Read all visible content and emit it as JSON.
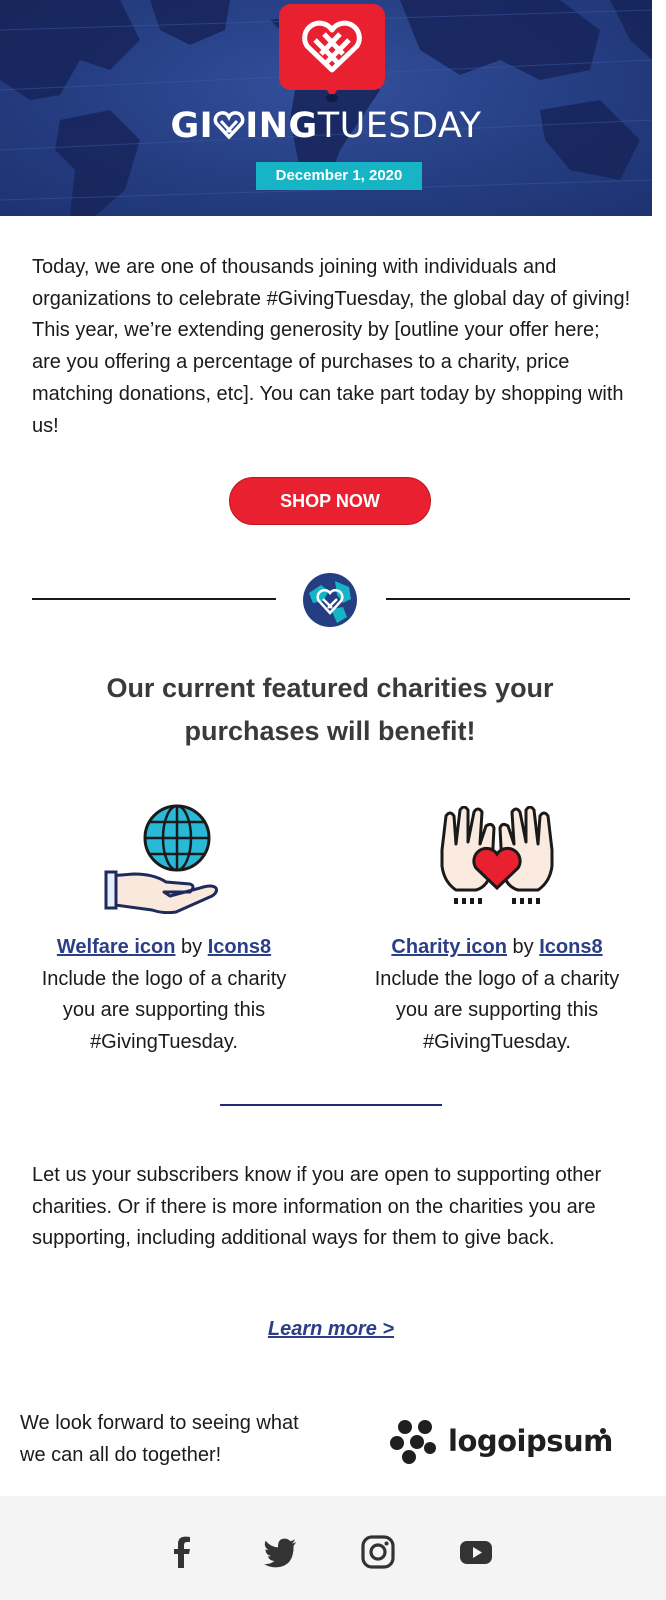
{
  "hero": {
    "brand_part1": "GI",
    "brand_part2": "ING",
    "brand_part3": "TUESDAY",
    "date": "December 1, 2020"
  },
  "intro_text": "Today, we are one of thousands joining with individuals and organizations to celebrate #GivingTuesday, the global day of giving! This year, we’re extending generosity by [outline your offer here; are you offering a percentage of purchases to a charity, price matching donations, etc]. You can take part today by shopping with us!",
  "shop_button": "SHOP NOW",
  "featured_heading": "Our current featured charities your purchases will benefit!",
  "charities": [
    {
      "icon_link": "Welfare icon",
      "by": "by",
      "author_link": "Icons8",
      "description": "Include the logo of a charity you are supporting this #GivingTuesday."
    },
    {
      "icon_link": "Charity icon",
      "by": "by",
      "author_link": "Icons8",
      "description": "Include the logo of a charity you are supporting this #GivingTuesday."
    }
  ],
  "outro_text": "Let us your subscribers know if you are open to supporting other charities. Or if there is more information on the charities you are supporting, including additional ways for them to give back.",
  "learn_more": "Learn more >",
  "closing_text": "We look forward to seeing what we can all do together!",
  "partner_logo_text": "logoipsum",
  "social_icons": [
    "facebook-icon",
    "twitter-icon",
    "instagram-icon",
    "youtube-icon"
  ],
  "colors": {
    "brand_red": "#e8202f",
    "hero_blue": "#253e82",
    "date_teal": "#17b4c5",
    "link_blue": "#2b3e86",
    "footer_bg": "#f4f4f4"
  }
}
